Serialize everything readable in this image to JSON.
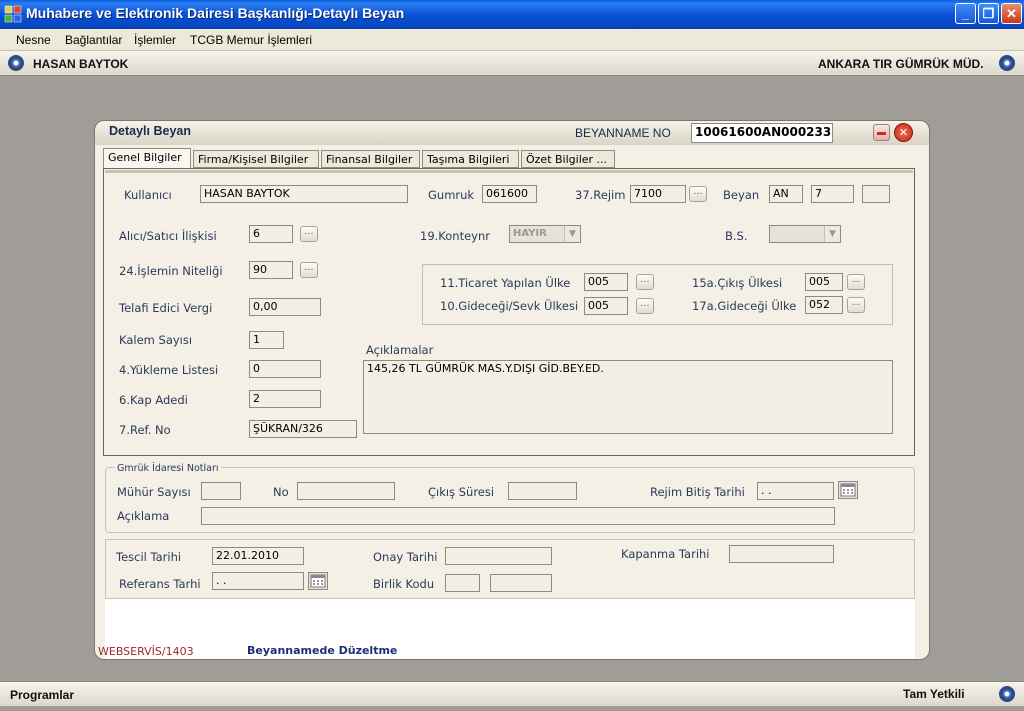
{
  "window": {
    "title": "Muhabere ve Elektronik Dairesi Başkanlığı-Detaylı Beyan",
    "minimize": "_",
    "maximize": "❐",
    "close": "✕"
  },
  "menu": [
    "Nesne",
    "Bağlantılar",
    "İşlemler",
    "TCGB Memur İşlemleri"
  ],
  "user_strip": {
    "user": "HASAN BAYTOK",
    "office": "ANKARA TIR GÜMRÜK MÜD."
  },
  "bottom_strip": {
    "left": "Programlar",
    "right": "Tam Yetkili"
  },
  "dialog": {
    "title": "Detaylı Beyan",
    "beyanname_label": "BEYANNAME NO",
    "beyanname_no": "10061600AN000233",
    "minimize_icon": "minus-icon",
    "close_icon": "close-icon",
    "tabs": [
      "Genel Bilgiler",
      "Firma/Kişisel Bilgiler",
      "Finansal Bilgiler",
      "Taşıma Bilgileri",
      "Özet Bilgiler ..."
    ],
    "general": {
      "kullanici_label": "Kullanıcı",
      "kullanici": "HASAN BAYTOK",
      "gumruk_label": "Gumruk",
      "gumruk": "061600",
      "rejim_label": "37.Rejim",
      "rejim": "7100",
      "beyan_label": "Beyan",
      "beyan_1": "AN",
      "beyan_2": "7",
      "beyan_3": "",
      "alici_label": "Alıcı/Satıcı İlişkisi",
      "alici": "6",
      "konteynr_label": "19.Konteynr",
      "konteynr": "HAYIR",
      "bs_label": "B.S.",
      "bs": "",
      "nitelik_label": "24.İşlemin Niteliği",
      "nitelik": "90",
      "ticaret_label": "11.Ticaret Yapılan Ülke",
      "ticaret": "005",
      "cikis_label": "15a.Çıkış Ülkesi",
      "cikis": "005",
      "gidecegi_sevk_label": "10.Gideceği/Sevk Ülkesi",
      "gidecegi_sevk": "005",
      "gidecegi_label": "17a.Gideceği Ülke",
      "gidecegi": "052",
      "telafi_label": "Telafi Edici Vergi",
      "telafi": "0,00",
      "kalem_label": "Kalem Sayısı",
      "kalem": "1",
      "yukleme_label": "4.Yükleme Listesi",
      "yukleme": "0",
      "kap_label": "6.Kap Adedi",
      "kap": "2",
      "ref_label": "7.Ref. No",
      "ref": "ŞÜKRAN/326",
      "aciklamalar_label": "Açıklamalar",
      "aciklamalar": "145,26  TL GÜMRÜK MAS.Y.DIŞI GİD.BEY.ED."
    },
    "notes": {
      "group_label": "Gmrük İdaresi Notları",
      "muhur_label": "Mühür Sayısı",
      "muhur": "",
      "no_label": "No",
      "no": "",
      "cikis_suresi_label": "Çıkış Süresi",
      "cikis_suresi": "",
      "rejim_bitis_label": "Rejim Bitiş Tarihi",
      "rejim_bitis": " . .",
      "aciklama_label": "Açıklama",
      "aciklama": ""
    },
    "registry": {
      "tescil_label": "Tescil Tarihi",
      "tescil": "22.01.2010",
      "onay_label": "Onay Tarihi",
      "onay": "",
      "kapanma_label": "Kapanma Tarihi",
      "kapanma": "",
      "referans_label": "Referans Tarhi",
      "referans": " . .",
      "birlik_label": "Birlik Kodu",
      "birlik_1": "",
      "birlik_2": ""
    },
    "status": {
      "service": "WEBSERVİS/1403",
      "message": "Beyannamede Düzeltme"
    }
  }
}
